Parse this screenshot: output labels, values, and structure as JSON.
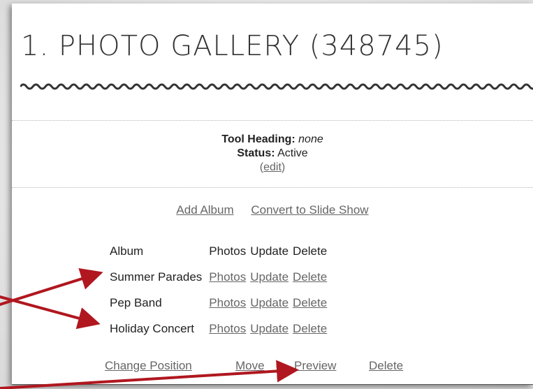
{
  "heading": {
    "title": "1. PHOTO GALLERY (348745)"
  },
  "tool_info": {
    "heading_label": "Tool Heading:",
    "heading_value": "none",
    "status_label": "Status:",
    "status_value": "Active",
    "edit_open": "(",
    "edit_label": "edit",
    "edit_close": ")"
  },
  "toolbar": {
    "add_album": "Add Album",
    "convert": "Convert to Slide Show"
  },
  "albums": {
    "headers": [
      "Album",
      "Photos",
      "Update",
      "Delete"
    ],
    "rows": [
      {
        "name": "Summer Parades",
        "photos": "Photos",
        "update": "Update",
        "delete": "Delete"
      },
      {
        "name": "Pep Band",
        "photos": "Photos",
        "update": "Update",
        "delete": "Delete"
      },
      {
        "name": "Holiday Concert",
        "photos": "Photos",
        "update": "Update",
        "delete": "Delete"
      }
    ]
  },
  "bottom_actions": {
    "change_position": "Change Position",
    "move": "Move",
    "preview": "Preview",
    "delete": "Delete"
  },
  "colors": {
    "annotation_arrow": "#b0171f",
    "link": "#666666",
    "text": "#222222"
  }
}
